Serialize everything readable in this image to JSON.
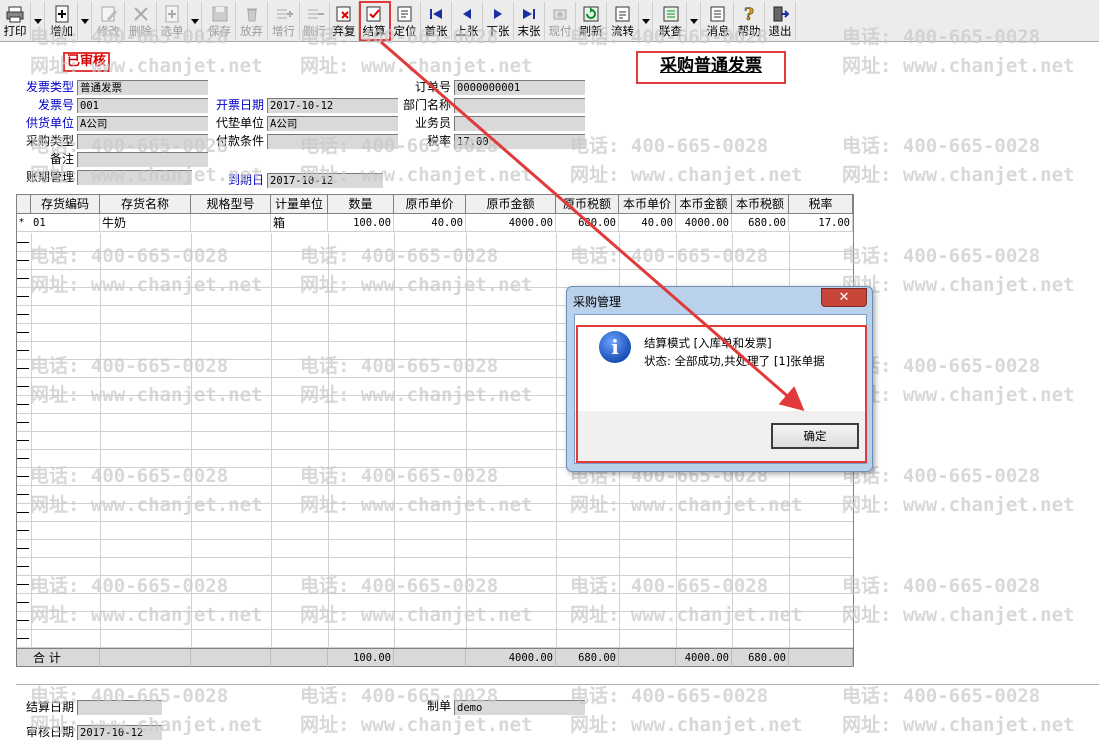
{
  "toolbar": {
    "buttons": [
      {
        "label": "打印",
        "icon": "printer-icon",
        "enabled": true
      },
      {
        "label": "增加",
        "icon": "add-doc-icon",
        "enabled": true
      },
      {
        "label": "修改",
        "icon": "edit-icon",
        "enabled": false
      },
      {
        "label": "删除",
        "icon": "delete-icon",
        "enabled": false
      },
      {
        "label": "选单",
        "icon": "select-doc-icon",
        "enabled": false
      },
      {
        "label": "保存",
        "icon": "save-icon",
        "enabled": false
      },
      {
        "label": "放弃",
        "icon": "discard-icon",
        "enabled": false
      },
      {
        "label": "增行",
        "icon": "add-row-icon",
        "enabled": false
      },
      {
        "label": "删行",
        "icon": "delete-row-icon",
        "enabled": false
      },
      {
        "label": "弃复",
        "icon": "unapprove-icon",
        "enabled": true
      },
      {
        "label": "结算",
        "icon": "settle-icon",
        "enabled": true
      },
      {
        "label": "定位",
        "icon": "locate-icon",
        "enabled": true
      },
      {
        "label": "首张",
        "icon": "first-record-icon",
        "enabled": true
      },
      {
        "label": "上张",
        "icon": "prev-record-icon",
        "enabled": true
      },
      {
        "label": "下张",
        "icon": "next-record-icon",
        "enabled": true
      },
      {
        "label": "末张",
        "icon": "last-record-icon",
        "enabled": true
      },
      {
        "label": "现付",
        "icon": "pay-icon",
        "enabled": false
      },
      {
        "label": "刷新",
        "icon": "refresh-icon",
        "enabled": true
      },
      {
        "label": "流转",
        "icon": "flow-icon",
        "enabled": true
      },
      {
        "label": "联查",
        "icon": "link-query-icon",
        "enabled": true
      },
      {
        "label": "消息",
        "icon": "message-icon",
        "enabled": true
      },
      {
        "label": "帮助",
        "icon": "help-icon",
        "enabled": true
      },
      {
        "label": "退出",
        "icon": "exit-icon",
        "enabled": true
      }
    ]
  },
  "watermark": {
    "phone": "电话: 400-665-0028",
    "site": "网址: www.chanjet.net"
  },
  "header": {
    "status": "已审核",
    "title": "采购普通发票",
    "fields": {
      "invoice_type": {
        "label": "发票类型",
        "value": "普通发票"
      },
      "invoice_no": {
        "label": "发票号",
        "value": "001"
      },
      "supplier": {
        "label": "供货单位",
        "value": "A公司"
      },
      "purchase_type": {
        "label": "采购类型",
        "value": ""
      },
      "remark": {
        "label": "备注",
        "value": ""
      },
      "period": {
        "label": "账期管理",
        "value": ""
      },
      "invoice_date": {
        "label": "开票日期",
        "value": "2017-10-12"
      },
      "advance_unit": {
        "label": "代垫单位",
        "value": "A公司"
      },
      "payment_terms": {
        "label": "付款条件",
        "value": ""
      },
      "due_date": {
        "label": "到期日",
        "value": "2017-10-12"
      },
      "order_no": {
        "label": "订单号",
        "value": "0000000001"
      },
      "department": {
        "label": "部门名称",
        "value": ""
      },
      "salesman": {
        "label": "业务员",
        "value": ""
      },
      "tax_rate": {
        "label": "税率",
        "value": "17.00"
      }
    }
  },
  "grid": {
    "columns": [
      "存货编码",
      "存货名称",
      "规格型号",
      "计量单位",
      "数量",
      "原币单价",
      "原币金额",
      "原币税额",
      "本币单价",
      "本币金额",
      "本币税额",
      "税率"
    ],
    "rows": [
      {
        "marker": "*",
        "cells": [
          "01",
          "牛奶",
          "",
          "箱",
          "100.00",
          "40.00",
          "4000.00",
          "680.00",
          "40.00",
          "4000.00",
          "680.00",
          "17.00"
        ]
      }
    ],
    "total": {
      "label": "合 计",
      "cells": [
        "",
        "",
        "",
        "",
        "100.00",
        "",
        "4000.00",
        "680.00",
        "",
        "4000.00",
        "680.00",
        ""
      ]
    }
  },
  "footer": {
    "settle_date": {
      "label": "结算日期",
      "value": ""
    },
    "audit_date": {
      "label": "审核日期",
      "value": "2017-10-12"
    },
    "maker": {
      "label": "制单",
      "value": "demo"
    }
  },
  "dialog": {
    "title": "采购管理",
    "line1": "结算模式 [入库单和发票]",
    "line2": "状态: 全部成功,共处理了 [1]张单据",
    "ok_label": "确定",
    "close_glyph": "✕",
    "icon_glyph": "i"
  },
  "colors": {
    "highlight": "#e03a3a",
    "label_blue": "#0000c8",
    "status_red": "#d40000"
  }
}
